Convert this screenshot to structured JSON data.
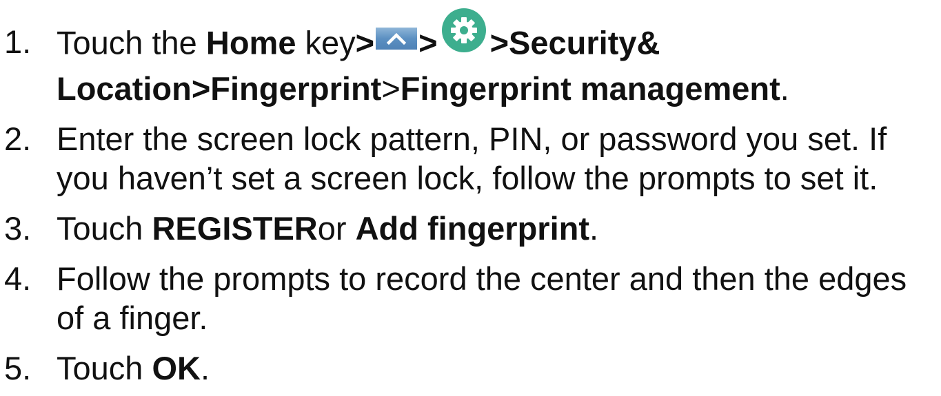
{
  "steps": [
    {
      "number": "1.",
      "parts": {
        "a": "Touch the ",
        "b": "Home",
        "c": " key",
        "d": ">",
        "e": ">",
        "f": ">Security&",
        "g": "Location>Fingerprint",
        "h": ">",
        "i": "Fingerprint management",
        "j": "."
      }
    },
    {
      "number": "2.",
      "text": "Enter the screen lock pattern, PIN, or password you set. If you haven’t set a screen lock, follow the prompts to set it."
    },
    {
      "number": "3.",
      "parts": {
        "a": "Touch ",
        "b": "REGISTER",
        "c": "or ",
        "d": "Add fingerprint",
        "e": "."
      }
    },
    {
      "number": "4.",
      "text": "Follow the prompts to record the center and then the edges of a finger."
    },
    {
      "number": "5.",
      "parts": {
        "a": "Touch ",
        "b": "OK",
        "c": "."
      }
    }
  ],
  "icons": {
    "up": "chevron-up-icon",
    "settings": "settings-gear-icon",
    "gear_color": "#3dae8e",
    "up_color": "#5c90c2"
  }
}
